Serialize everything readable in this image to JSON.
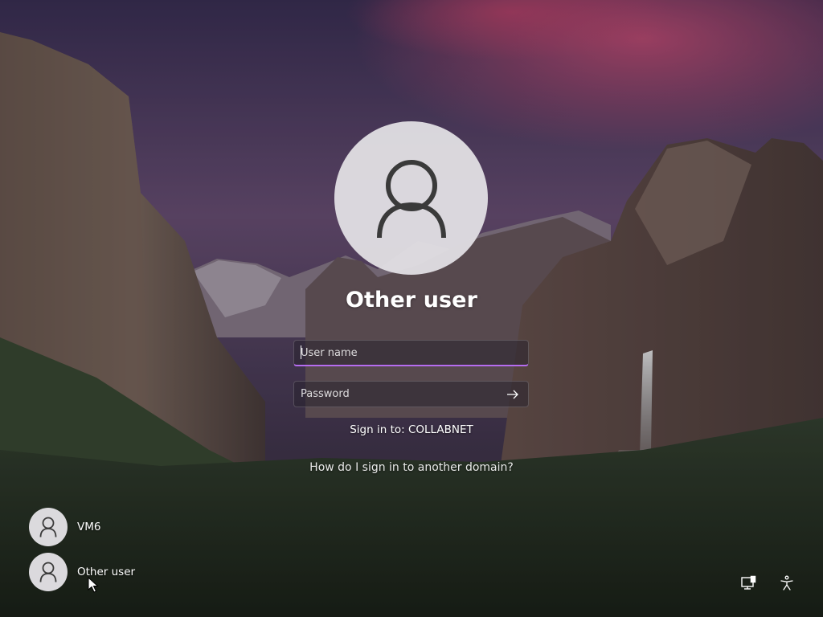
{
  "login": {
    "display_name": "Other user",
    "username_placeholder": "User name",
    "username_value": "",
    "password_placeholder": "Password",
    "signin_domain_text": "Sign in to: COLLABNET",
    "help_link": "How do I sign in to another domain?"
  },
  "users": [
    {
      "name": "VM6",
      "icon": "person-icon"
    },
    {
      "name": "Other user",
      "icon": "person-icon"
    }
  ],
  "system_buttons": [
    {
      "icon": "network-icon"
    },
    {
      "icon": "accessibility-icon"
    }
  ],
  "colors": {
    "focus_accent": "#b56cf0",
    "avatar_bg": "#e1dfe4",
    "avatar_glyph": "#3a3a3a"
  }
}
